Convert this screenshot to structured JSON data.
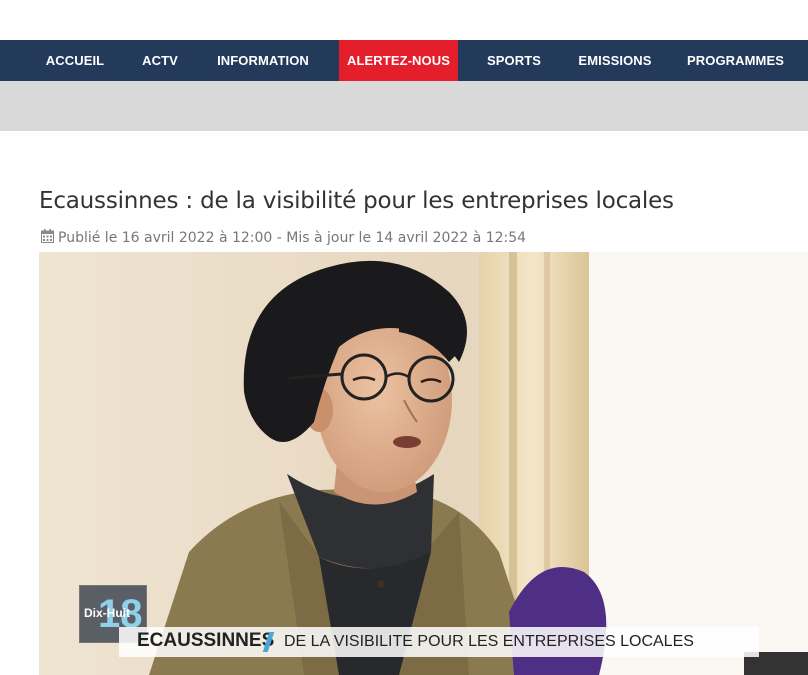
{
  "nav": {
    "items": [
      {
        "label": "ACCUEIL"
      },
      {
        "label": "ACTV"
      },
      {
        "label": "INFORMATION"
      },
      {
        "label": "ALERTEZ-NOUS"
      },
      {
        "label": "SPORTS"
      },
      {
        "label": "EMISSIONS"
      },
      {
        "label": "PROGRAMMES"
      }
    ],
    "active_color": "#e41e2b",
    "bar_color": "#233a5b"
  },
  "article": {
    "title": "Ecaussinnes : de la visibilité pour les entreprises locales",
    "meta_icon": "calendar-icon",
    "meta": "Publié le 16 avril 2022 à 12:00 - Mis à jour le 14 avril 2022 à 12:54"
  },
  "video_overlay": {
    "logo_text": "Dix-Huit",
    "logo_number": "18",
    "location": "ECAUSSINNES",
    "headline": "DE LA VISIBILITE POUR LES ENTREPRISES LOCALES"
  }
}
